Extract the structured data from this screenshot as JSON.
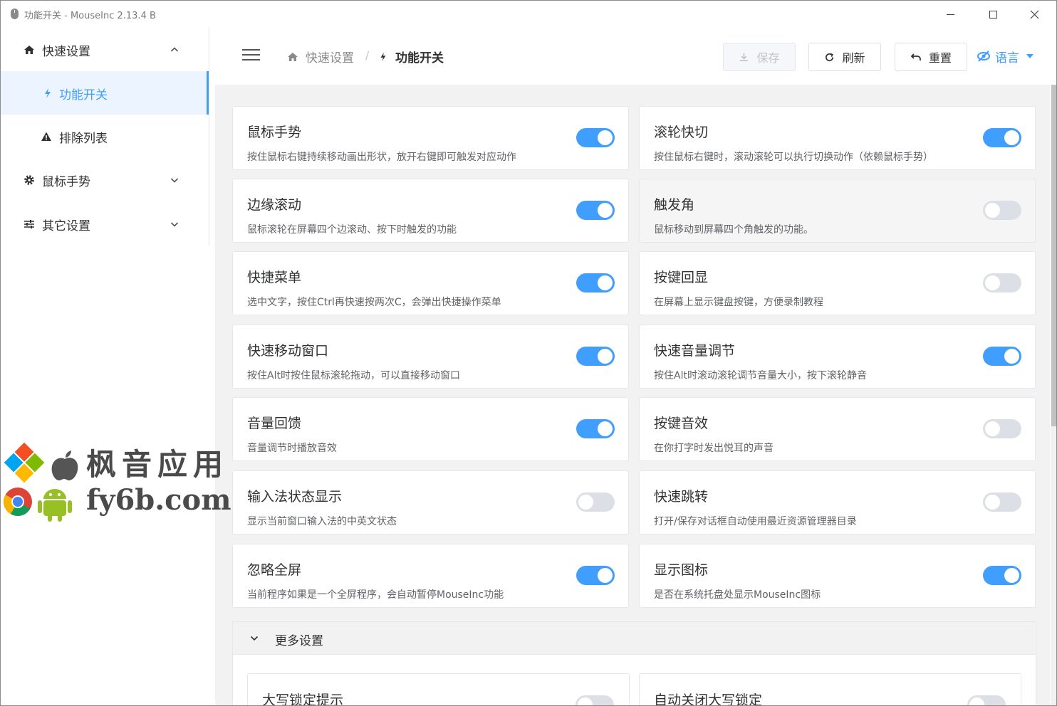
{
  "window": {
    "title": "功能开关 - MouseInc 2.13.4 B"
  },
  "sidebar": {
    "items": [
      {
        "label": "快速设置",
        "icon": "home-icon",
        "expanded": true
      },
      {
        "label": "功能开关",
        "icon": "bolt-icon",
        "active": true
      },
      {
        "label": "排除列表",
        "icon": "warning-icon"
      },
      {
        "label": "鼠标手势",
        "icon": "gear-icon",
        "expanded": false
      },
      {
        "label": "其它设置",
        "icon": "sliders-icon",
        "expanded": false
      }
    ]
  },
  "header": {
    "breadcrumb": {
      "home": "快速设置",
      "separator": "/",
      "current": "功能开关"
    },
    "save_label": "保存",
    "refresh_label": "刷新",
    "reset_label": "重置",
    "lang_label": "语言"
  },
  "features": [
    {
      "title": "鼠标手势",
      "desc": "按住鼠标右键持续移动画出形状，放开右键即可触发对应动作",
      "enabled": true
    },
    {
      "title": "滚轮快切",
      "desc": "按住鼠标右键时，滚动滚轮可以执行切换动作（依赖鼠标手势）",
      "enabled": true
    },
    {
      "title": "边缘滚动",
      "desc": "鼠标滚轮在屏幕四个边滚动、按下时触发的功能",
      "enabled": true
    },
    {
      "title": "触发角",
      "desc": "鼠标移动到屏幕四个角触发的功能。",
      "enabled": false
    },
    {
      "title": "快捷菜单",
      "desc": "选中文字，按住Ctrl再快速按两次C，会弹出快捷操作菜单",
      "enabled": true
    },
    {
      "title": "按键回显",
      "desc": "在屏幕上显示键盘按键，方便录制教程",
      "enabled": false
    },
    {
      "title": "快速移动窗口",
      "desc": "按住Alt时按住鼠标滚轮拖动，可以直接移动窗口",
      "enabled": true
    },
    {
      "title": "快速音量调节",
      "desc": "按住Alt时滚动滚轮调节音量大小，按下滚轮静音",
      "enabled": true
    },
    {
      "title": "音量回馈",
      "desc": "音量调节时播放音效",
      "enabled": true
    },
    {
      "title": "按键音效",
      "desc": "在你打字时发出悦耳的声音",
      "enabled": false
    },
    {
      "title": "输入法状态显示",
      "desc": "显示当前窗口输入法的中英文状态",
      "enabled": false
    },
    {
      "title": "快速跳转",
      "desc": "打开/保存对话框自动使用最近资源管理器目录",
      "enabled": false
    },
    {
      "title": "忽略全屏",
      "desc": "当前程序如果是一个全屏程序，会自动暂停MouseInc功能",
      "enabled": true
    },
    {
      "title": "显示图标",
      "desc": "是否在系统托盘处显示MouseInc图标",
      "enabled": true
    }
  ],
  "more": {
    "label": "更多设置",
    "items": [
      {
        "title": "大写锁定提示",
        "enabled": false
      },
      {
        "title": "自动关闭大写锁定",
        "enabled": false
      }
    ]
  },
  "watermark": {
    "line1": "枫音应用",
    "line2": "fy6b.com"
  },
  "colors": {
    "accent": "#409eff",
    "switch_off": "#dcdfe6",
    "content_bg": "#f2f2f2"
  }
}
